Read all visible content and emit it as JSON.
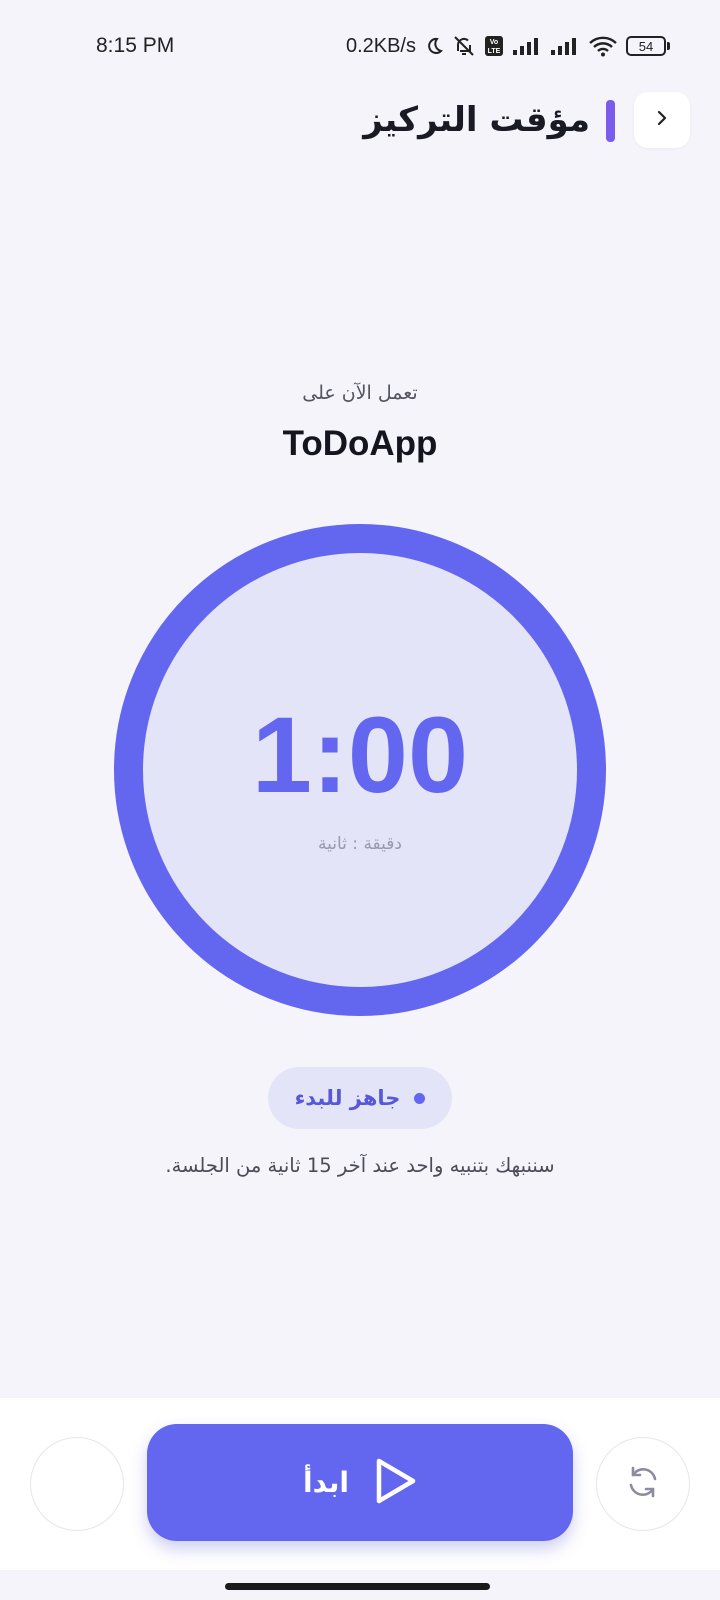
{
  "status_bar": {
    "time": "8:15 PM",
    "network_speed": "0.2KB/s",
    "battery_level": "54",
    "icons": [
      "moon-icon",
      "bell-off-icon",
      "volte-icon",
      "signal-icon",
      "signal-icon",
      "wifi-icon",
      "battery-icon"
    ]
  },
  "header": {
    "title": "مؤقت التركيز",
    "back_icon": "chevron-right-icon"
  },
  "task": {
    "label": "تعمل الآن على",
    "name": "ToDoApp"
  },
  "timer": {
    "value": "1:00",
    "units": "دقيقة : ثانية"
  },
  "status": {
    "label": "جاهز للبدء"
  },
  "notice": "سننبهك بتنبيه واحد عند آخر 15 ثانية من الجلسة.",
  "controls": {
    "start_label": "ابدأ",
    "start_icon": "play-icon",
    "reset_icon": "refresh-icon"
  },
  "colors": {
    "accent": "#6366ef",
    "title_accent": "#7b5bea",
    "ring_fill": "#e3e4f8",
    "background": "#f4f4fa"
  }
}
